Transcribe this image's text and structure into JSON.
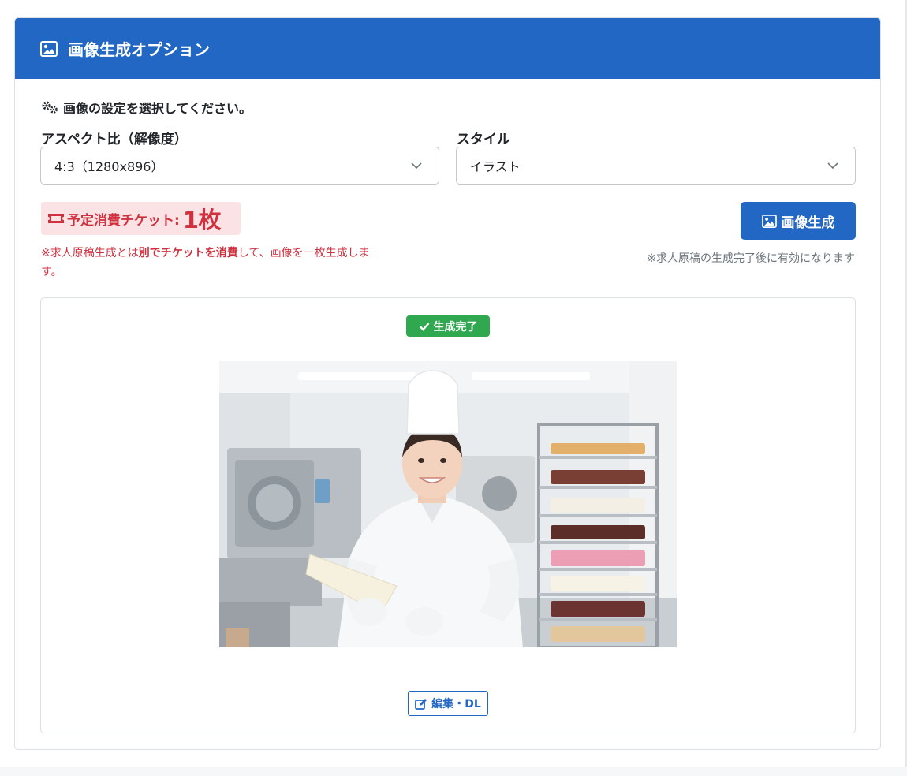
{
  "header": {
    "title": "画像生成オプション",
    "icon": "image-icon"
  },
  "intro": {
    "text": "画像の設定を選択してください。",
    "icon": "gears-icon"
  },
  "aspect": {
    "label": "アスペクト比（解像度）",
    "value": "4:3（1280x896）"
  },
  "style": {
    "label": "スタイル",
    "value": "イラスト"
  },
  "ticket": {
    "icon": "ticket-icon",
    "label": "予定消費チケット:",
    "count": "1枚"
  },
  "note_left": {
    "part1": "※求人原稿生成とは",
    "bold": "別でチケットを消費",
    "part2": "して、画像を一枚生成します。"
  },
  "generate_button": {
    "label": "画像生成",
    "icon": "image-icon"
  },
  "note_right": "※求人原稿の生成完了後に有効になります",
  "result": {
    "status_badge": "生成完了",
    "edit_button": "編集・DL",
    "image_subject": "pastry chef in white uniform holding piping bag in kitchen with cake rack"
  },
  "colors": {
    "primary": "#2267c4",
    "success": "#2fa84f",
    "danger": "#d0313f",
    "danger_bg": "#fbe2e5",
    "muted": "#6c757d"
  }
}
